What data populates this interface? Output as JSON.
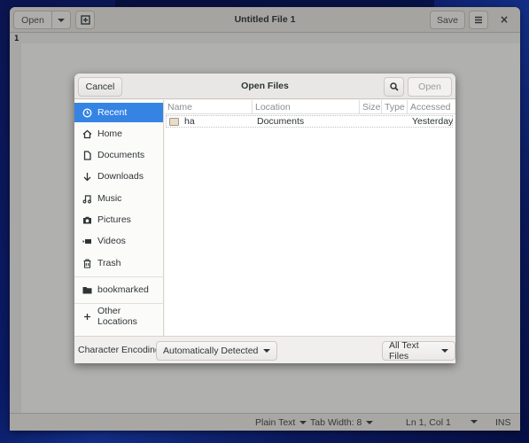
{
  "editor": {
    "title": "Untitled File 1",
    "open_label": "Open",
    "save_label": "Save",
    "close_glyph": "×",
    "line_number": "1",
    "status": {
      "language": "Plain Text",
      "tab_width": "Tab Width: 8",
      "position": "Ln 1, Col 1",
      "mode": "INS"
    }
  },
  "dialog": {
    "title": "Open Files",
    "cancel_label": "Cancel",
    "open_label": "Open",
    "sidebar": {
      "items": [
        {
          "label": "Recent",
          "icon": "clock-icon",
          "active": true
        },
        {
          "label": "Home",
          "icon": "home-icon"
        },
        {
          "label": "Documents",
          "icon": "document-icon"
        },
        {
          "label": "Downloads",
          "icon": "download-icon"
        },
        {
          "label": "Music",
          "icon": "music-icon"
        },
        {
          "label": "Pictures",
          "icon": "camera-icon"
        },
        {
          "label": "Videos",
          "icon": "video-icon"
        },
        {
          "label": "Trash",
          "icon": "trash-icon"
        }
      ],
      "bookmarks": [
        {
          "label": "bookmarked",
          "icon": "folder-icon"
        }
      ],
      "other": {
        "label": "Other Locations",
        "icon": "plus-icon"
      }
    },
    "columns": [
      "Name",
      "Location",
      "Size",
      "Type",
      "Accessed"
    ],
    "files": [
      {
        "name": "ha",
        "location": "Documents",
        "size": "",
        "type": "",
        "accessed": "Yesterday"
      }
    ],
    "footer": {
      "encoding_label": "Character Encoding:",
      "encoding_value": "Automatically Detected",
      "filter_value": "All Text Files"
    }
  }
}
